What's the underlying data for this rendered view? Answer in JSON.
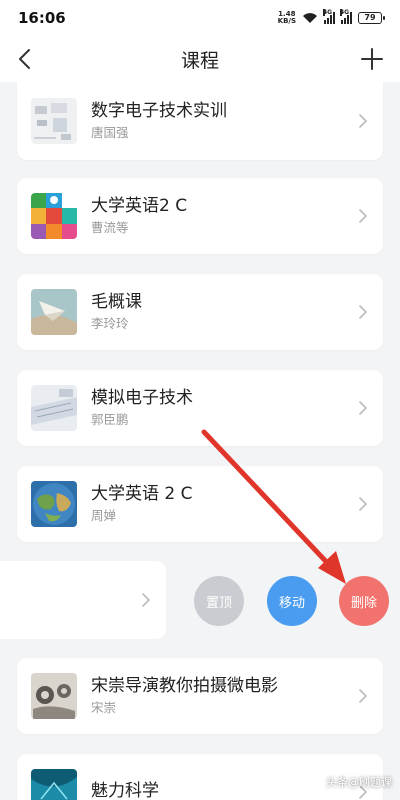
{
  "status_bar": {
    "time": "16:06",
    "net_speed_value": "1.48",
    "net_speed_unit": "KB/S",
    "signal1_tag": "4G",
    "signal2_tag": "4G",
    "battery": "79"
  },
  "nav": {
    "title": "课程"
  },
  "courses": [
    {
      "name": "数字电子技术实训",
      "teacher": "唐国强"
    },
    {
      "name": "大学英语2 C",
      "teacher": "曹流等"
    },
    {
      "name": "毛概课",
      "teacher": "李玲玲"
    },
    {
      "name": "模拟电子技术",
      "teacher": "郭臣鹏"
    },
    {
      "name": "大学英语 2 C",
      "teacher": "周婵"
    },
    {
      "name": "宋崇导演教你拍摄微电影",
      "teacher": "宋崇"
    },
    {
      "name": "魅力科学",
      "teacher": ""
    }
  ],
  "swipe_actions": {
    "pin": "置顶",
    "move": "移动",
    "delete": "删除"
  },
  "colors": {
    "pin": "#c9ccd0",
    "move": "#4a9cf0",
    "delete": "#f2736d",
    "arrow": "#e0352b"
  },
  "watermark": "头条@刷题课"
}
